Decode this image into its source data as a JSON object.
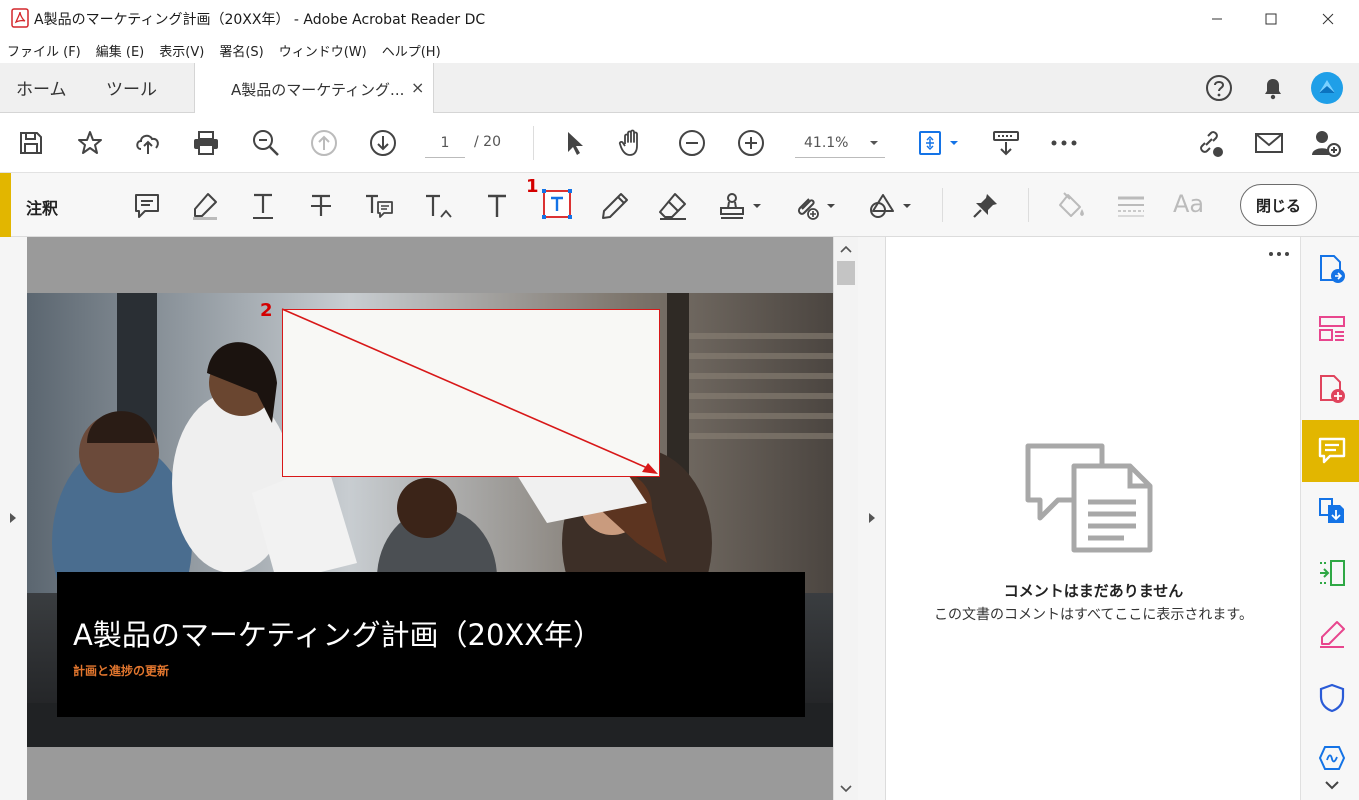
{
  "window": {
    "title": "A製品のマーケティング計画（20XX年） - Adobe Acrobat Reader DC"
  },
  "menu": [
    "ファイル (F)",
    "編集 (E)",
    "表示(V)",
    "署名(S)",
    "ウィンドウ(W)",
    "ヘルプ(H)"
  ],
  "tabs": {
    "home": "ホーム",
    "tools": "ツール",
    "document": "A製品のマーケティング...",
    "close": "×"
  },
  "toolbar": {
    "page_current": "1",
    "page_total": "/ 20",
    "zoom": "41.1%"
  },
  "comment_toolbar": {
    "label": "注釈",
    "close_button": "閉じる",
    "font_label": "Aa"
  },
  "steps": {
    "step1": "1",
    "step2": "2"
  },
  "slide": {
    "title": "A製品のマーケティング計画（20XX年）",
    "subtitle": "計画と進捗の更新"
  },
  "comments_pane": {
    "empty_title": "コメントはまだありません",
    "empty_subtitle": "この文書のコメントはすべてここに表示されます。"
  },
  "colors": {
    "accent": "#e2b600",
    "annotation_red": "#d81818",
    "subtitle_orange": "#e2762e"
  }
}
